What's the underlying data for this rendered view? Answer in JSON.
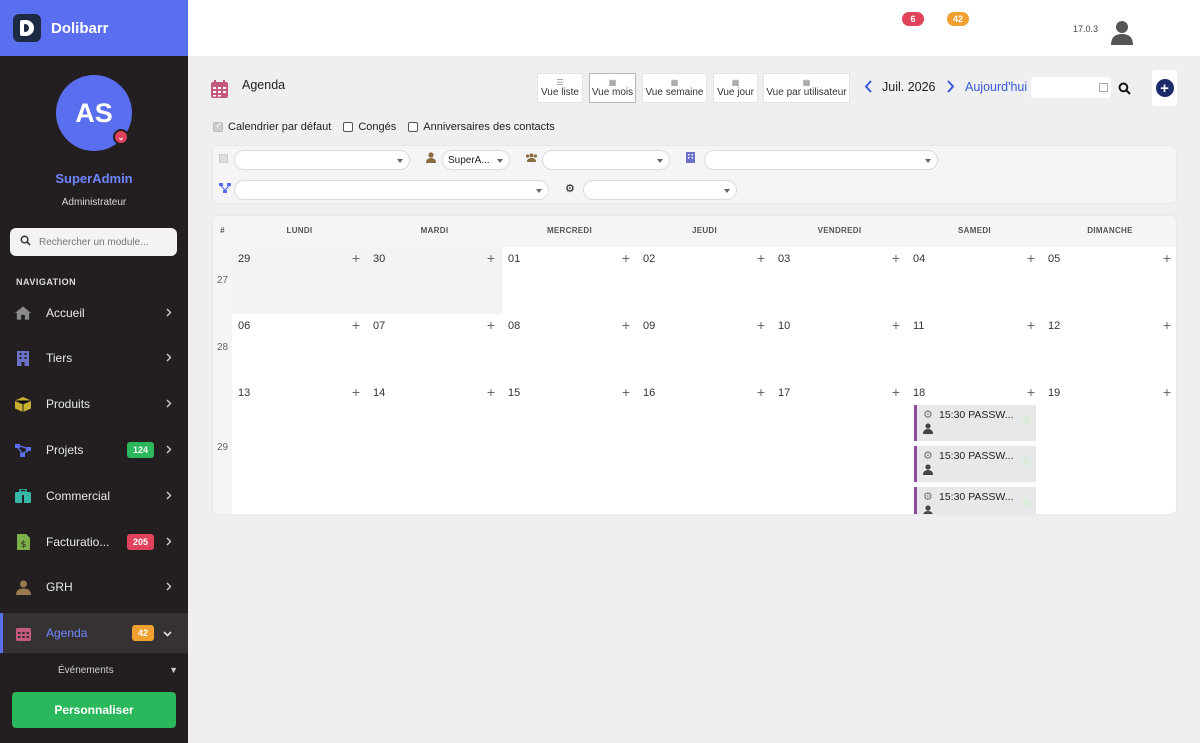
{
  "app": {
    "name": "Dolibarr",
    "version": "17.0.3"
  },
  "profile": {
    "initials": "AS",
    "name": "SuperAdmin",
    "role": "Administrateur"
  },
  "sidebar": {
    "search_placeholder": "Rechercher un module...",
    "nav_title": "NAVIGATION",
    "items": [
      {
        "label": "Accueil",
        "icon": "home-icon",
        "color": "#8a8a8a"
      },
      {
        "label": "Tiers",
        "icon": "building-icon",
        "color": "#6b72c8"
      },
      {
        "label": "Produits",
        "icon": "box-icon",
        "color": "#c9b032"
      },
      {
        "label": "Projets",
        "icon": "project-icon",
        "color": "#5a6ef0",
        "badge": "124",
        "badge_color": "#2bb85c"
      },
      {
        "label": "Commercial",
        "icon": "briefcase-icon",
        "color": "#36b7a8"
      },
      {
        "label": "Facturatio...",
        "icon": "invoice-icon",
        "color": "#7bb04a",
        "badge": "205",
        "badge_color": "#e0435b"
      },
      {
        "label": "GRH",
        "icon": "hr-icon",
        "color": "#9a7a50"
      },
      {
        "label": "Agenda",
        "icon": "calendar-icon",
        "color": "#c35a7a",
        "badge": "42",
        "badge_color": "#f0a030",
        "active": true
      }
    ],
    "subitem": "Événements",
    "customize_label": "Personnaliser"
  },
  "topbar": {
    "badge_red": "6",
    "badge_orange": "42"
  },
  "page": {
    "title": "Agenda",
    "views": [
      "Vue liste",
      "Vue mois",
      "Vue semaine",
      "Vue jour",
      "Vue par utilisateur"
    ],
    "active_view": "Vue mois",
    "month": "Juil. 2026",
    "today": "Aujourd'hui",
    "date_value": ""
  },
  "checkboxes": [
    {
      "label": "Calendrier par défaut",
      "checked": true,
      "disabled": true
    },
    {
      "label": "Congés",
      "checked": false
    },
    {
      "label": "Anniversaires des contacts",
      "checked": false
    }
  ],
  "filters": {
    "user_value": "SuperA..."
  },
  "calendar": {
    "week_col": "#",
    "days": [
      "LUNDI",
      "MARDI",
      "MERCREDI",
      "JEUDI",
      "VENDREDI",
      "SAMEDI",
      "DIMANCHE"
    ],
    "weeks": [
      {
        "num": "27",
        "dates": [
          "29",
          "30",
          "01",
          "02",
          "03",
          "04",
          "05"
        ],
        "off": [
          true,
          true,
          false,
          false,
          false,
          false,
          false
        ]
      },
      {
        "num": "28",
        "dates": [
          "06",
          "07",
          "08",
          "09",
          "10",
          "11",
          "12"
        ],
        "off": [
          false,
          false,
          false,
          false,
          false,
          false,
          false
        ]
      },
      {
        "num": "29",
        "dates": [
          "13",
          "14",
          "15",
          "16",
          "17",
          "18",
          "19"
        ],
        "off": [
          false,
          false,
          false,
          false,
          false,
          false,
          false
        ]
      }
    ],
    "events": [
      {
        "text": "15:30 PASSW..."
      },
      {
        "text": "15:30 PASSW..."
      },
      {
        "text": "15:30 PASSW..."
      }
    ]
  }
}
